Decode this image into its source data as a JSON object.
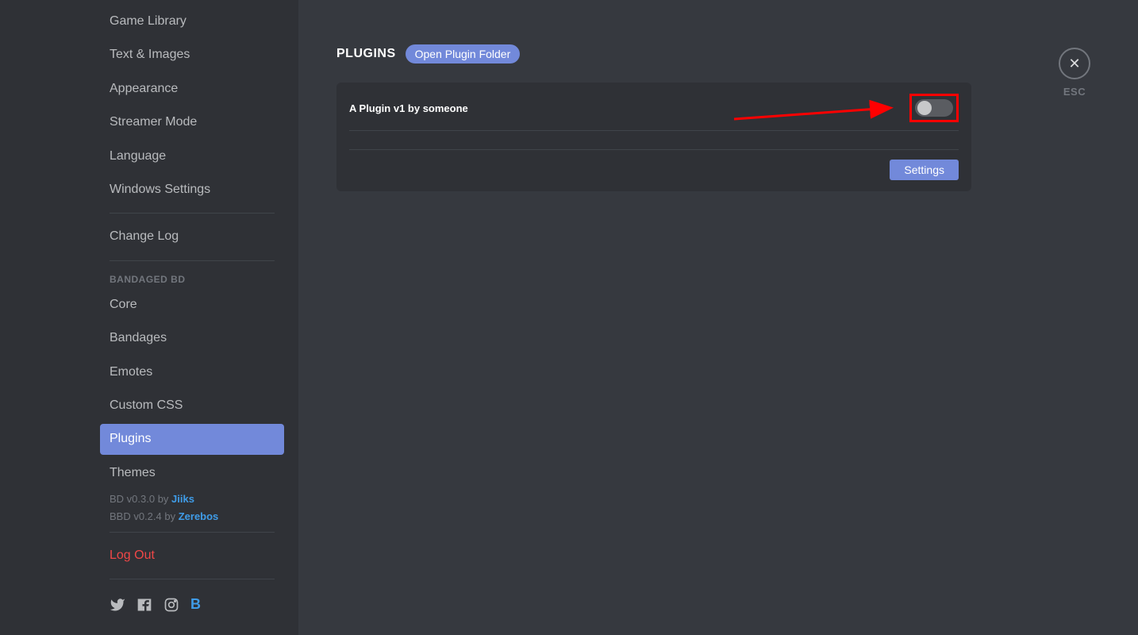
{
  "sidebar": {
    "items1": [
      {
        "label": "Game Library"
      },
      {
        "label": "Text & Images"
      },
      {
        "label": "Appearance"
      },
      {
        "label": "Streamer Mode"
      },
      {
        "label": "Language"
      },
      {
        "label": "Windows Settings"
      }
    ],
    "items2": [
      {
        "label": "Change Log"
      }
    ],
    "header_bd": "BANDAGED BD",
    "items3": [
      {
        "label": "Core"
      },
      {
        "label": "Bandages"
      },
      {
        "label": "Emotes"
      },
      {
        "label": "Custom CSS"
      },
      {
        "label": "Plugins"
      },
      {
        "label": "Themes"
      }
    ],
    "meta": {
      "bd_prefix": "BD v0.3.0 by ",
      "bd_author": "Jiiks",
      "bbd_prefix": "BBD v0.2.4 by ",
      "bbd_author": "Zerebos"
    },
    "logout": "Log Out"
  },
  "main": {
    "title": "PLUGINS",
    "open_folder": "Open Plugin Folder",
    "plugin": {
      "name": "A Plugin v1 by someone",
      "settings_label": "Settings",
      "enabled": false
    },
    "close": {
      "glyph": "✕",
      "label": "ESC"
    }
  }
}
